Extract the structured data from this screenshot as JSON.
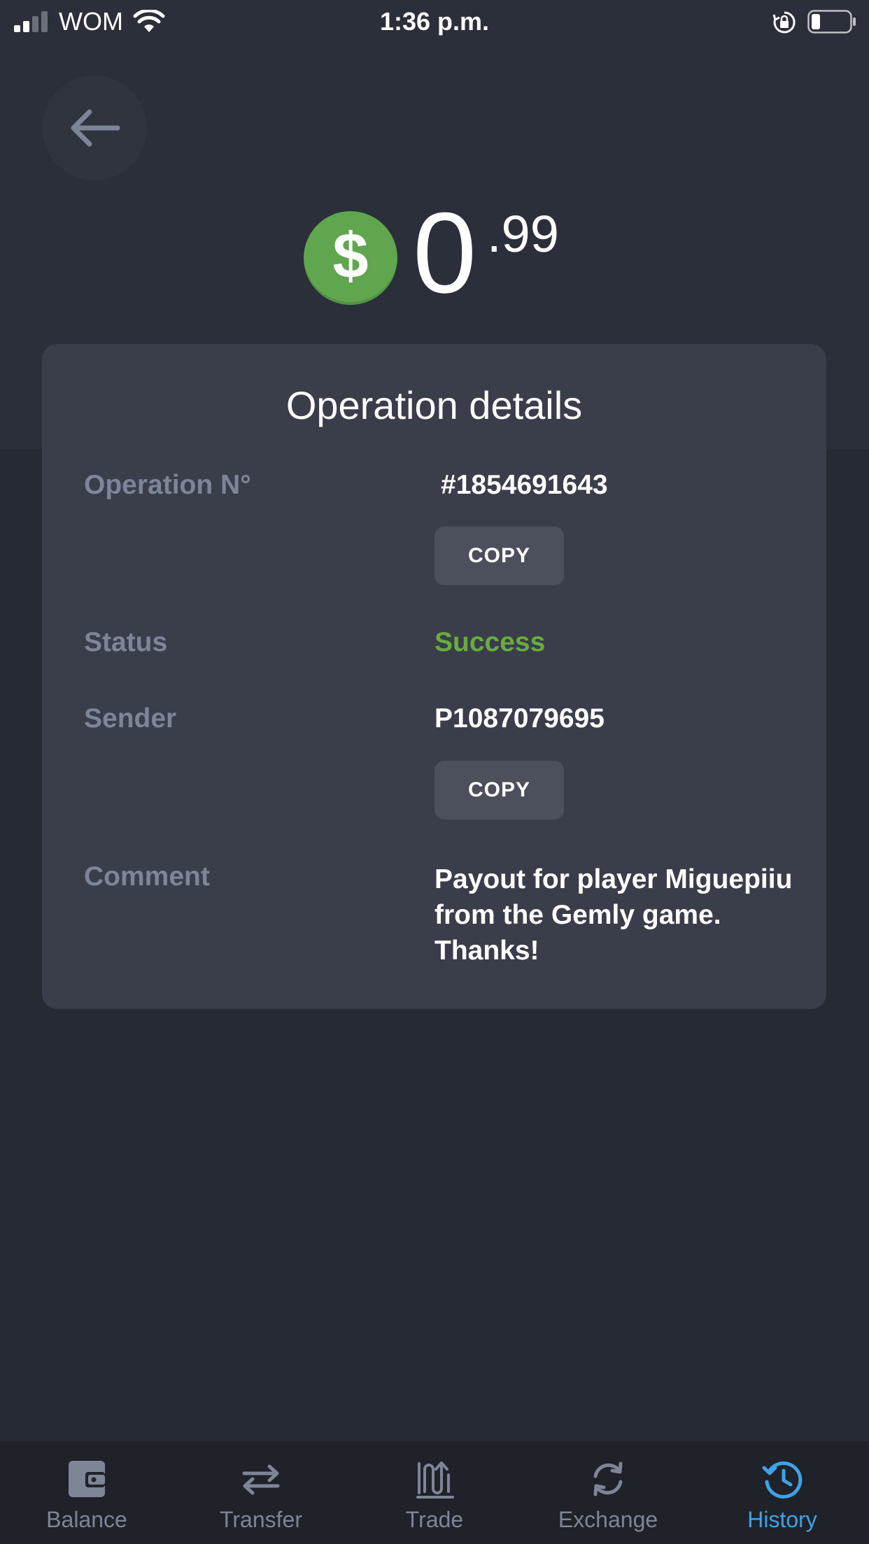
{
  "status_bar": {
    "carrier": "WOM",
    "time": "1:36 p.m."
  },
  "amount": {
    "integer": "0",
    "fraction": ".99",
    "coin_symbol": "$"
  },
  "card": {
    "title": "Operation details",
    "rows": [
      {
        "label": "Operation N°",
        "value": "#1854691643",
        "copy": "COPY"
      },
      {
        "label": "Status",
        "value": "Success"
      },
      {
        "label": "Sender",
        "value": "P1087079695",
        "copy": "COPY"
      },
      {
        "label": "Comment",
        "value": "Payout for player Miguepiiu from the Gemly game. Thanks!"
      }
    ]
  },
  "tabs": [
    {
      "label": "Balance",
      "icon": "wallet-icon",
      "active": false
    },
    {
      "label": "Transfer",
      "icon": "transfer-arrows-icon",
      "active": false
    },
    {
      "label": "Trade",
      "icon": "trade-chart-icon",
      "active": false
    },
    {
      "label": "Exchange",
      "icon": "exchange-cycle-icon",
      "active": false
    },
    {
      "label": "History",
      "icon": "history-clock-icon",
      "active": true
    }
  ],
  "colors": {
    "background": "#262a33",
    "header_band": "#2b2f39",
    "card": "#393e4a",
    "label": "#7d8596",
    "success": "#6aab3f",
    "coin": "#5fa64f",
    "active_tab": "#3fa2e6",
    "tab_bar": "#1f2229"
  }
}
